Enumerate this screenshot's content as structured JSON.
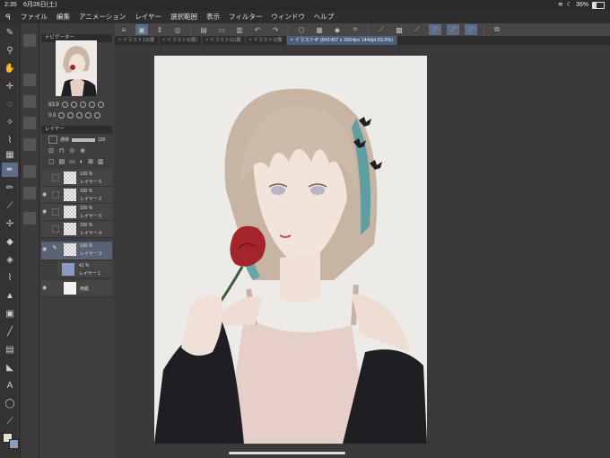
{
  "status": {
    "time": "2:35",
    "date": "6月26日(土)",
    "battery": "36%",
    "battery_level": 0.36
  },
  "menu": {
    "items": [
      "ファイル",
      "編集",
      "アニメーション",
      "レイヤー",
      "選択範囲",
      "表示",
      "フィルター",
      "ウィンドウ",
      "ヘルプ"
    ]
  },
  "tabs": [
    {
      "label": "イラスト13(複",
      "active": false
    },
    {
      "label": "イラスト9(複)",
      "active": false
    },
    {
      "label": "イラスト11(複",
      "active": false
    },
    {
      "label": "イラスト3(複",
      "active": false
    },
    {
      "label": "イラスト4* (841457 x 2064px 144dpi 83.9%)",
      "active": true
    }
  ],
  "navigator": {
    "title": "ナビゲーター",
    "zoom": "83.9",
    "angle": "0.0"
  },
  "layers_panel": {
    "title": "レイヤー",
    "blend_mode": "通常",
    "opacity": "100",
    "layers": [
      {
        "percent": "100 %",
        "mode": "通",
        "name": "レイヤー 6",
        "visible": false,
        "active": false
      },
      {
        "percent": "100 %",
        "mode": "通",
        "name": "レイヤー 2",
        "visible": true,
        "active": false
      },
      {
        "percent": "100 %",
        "mode": "通",
        "name": "レイヤー 5",
        "visible": true,
        "active": false
      },
      {
        "percent": "100 %",
        "mode": "通",
        "name": "レイヤー 4",
        "visible": false,
        "active": false
      },
      {
        "percent": "100 %",
        "mode": "通",
        "name": "レイヤー 3",
        "visible": true,
        "active": true
      },
      {
        "percent": "41 %",
        "mode": "",
        "name": "レイヤー 1",
        "visible": false,
        "active": false
      },
      {
        "percent": "",
        "mode": "",
        "name": "用紙",
        "visible": true,
        "active": false
      }
    ]
  },
  "icons": {
    "left_tools": [
      "pen-icon",
      "zoom-icon",
      "hand-icon",
      "move-icon",
      "lasso-icon",
      "wand-icon",
      "eyedropper-icon",
      "pen-icon",
      "pencil-icon",
      "brush-icon",
      "airbrush-icon",
      "decoration-icon",
      "eraser-icon",
      "fill-icon",
      "gradient-icon",
      "figure-icon",
      "frame-icon",
      "text-icon",
      "balloon-icon",
      "line-icon"
    ],
    "colors": {
      "main": "#e6e0d8",
      "sub": "#8c9bc4"
    }
  }
}
